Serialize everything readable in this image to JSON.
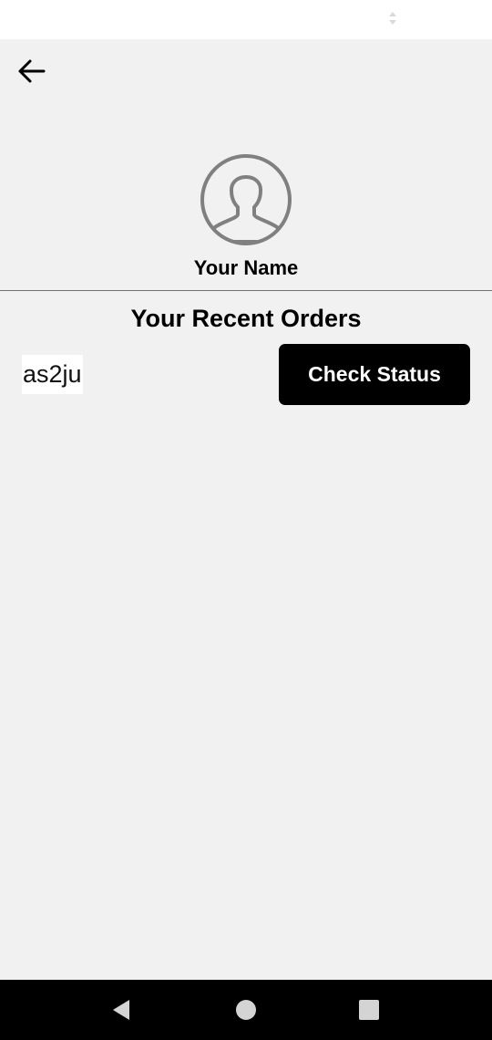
{
  "status_bar": {
    "icon": "sort-arrows-icon"
  },
  "header": {
    "back_icon": "arrow-left-icon"
  },
  "profile": {
    "avatar_icon": "user-avatar-icon",
    "name": "Your Name"
  },
  "orders": {
    "heading": "Your Recent Orders",
    "items": [
      {
        "id": "as2ju",
        "action_label": "Check Status"
      }
    ]
  },
  "nav_bar": {
    "back_icon": "nav-back-triangle-icon",
    "home_icon": "nav-home-circle-icon",
    "recents_icon": "nav-recents-square-icon"
  },
  "colors": {
    "background": "#f1f1f1",
    "status_bar": "#ffffff",
    "button": "#000000",
    "button_text": "#ffffff",
    "avatar_stroke": "#808080",
    "divider": "#6f6f6f",
    "nav_bar": "#000000",
    "nav_icons": "#d4d4d4"
  }
}
